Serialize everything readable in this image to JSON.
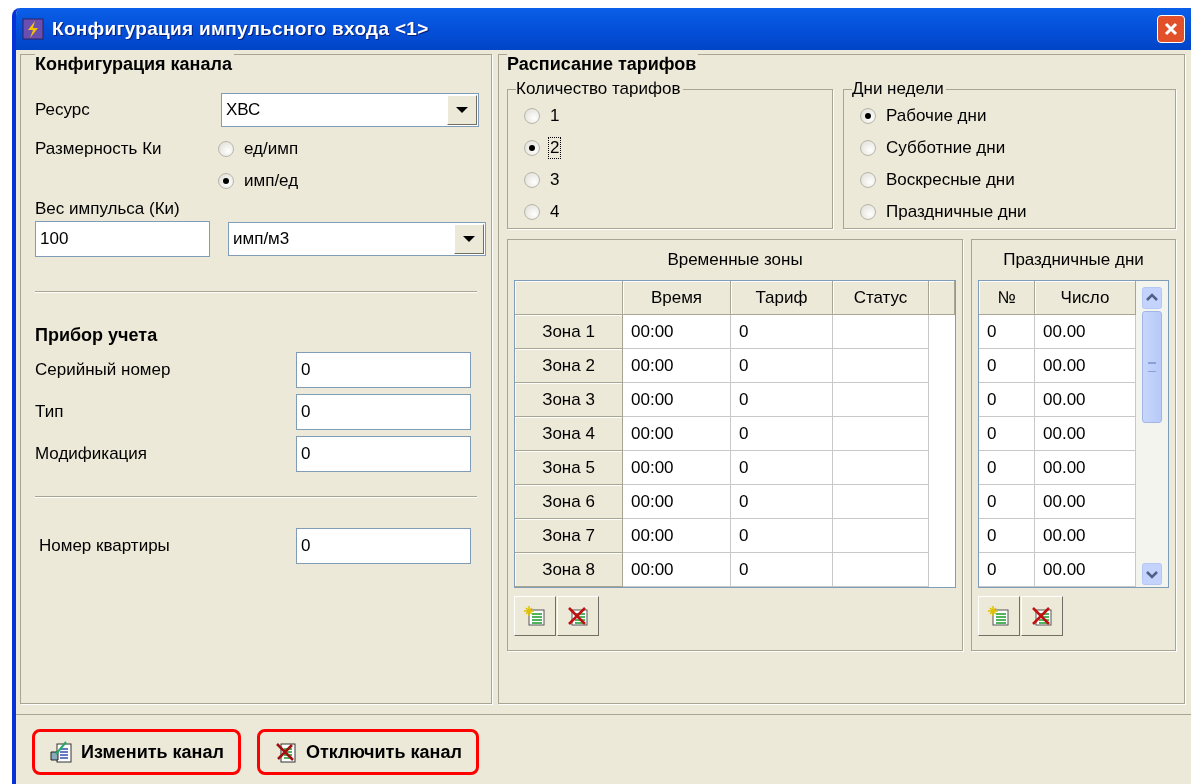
{
  "window": {
    "title": "Конфигурация импульсного входа <1>"
  },
  "channel_config": {
    "title": "Конфигурация канала",
    "resource": {
      "label": "Ресурс",
      "value": "ХВС"
    },
    "ki_dimension": {
      "label": "Размерность Ки",
      "options": [
        {
          "label": "ед/имп",
          "selected": false
        },
        {
          "label": "имп/ед",
          "selected": true
        }
      ]
    },
    "pulse_weight": {
      "label": "Вес импульса (Ки)",
      "value": "100",
      "unit": "имп/м3"
    }
  },
  "meter": {
    "title": "Прибор учета",
    "fields": [
      {
        "label": "Серийный номер",
        "value": "0"
      },
      {
        "label": "Тип",
        "value": "0"
      },
      {
        "label": "Модификация",
        "value": "0"
      }
    ]
  },
  "apartment": {
    "label": "Номер квартиры",
    "value": "0"
  },
  "tariff_schedule": {
    "title": "Расписание тарифов",
    "tariff_count": {
      "title": "Количество тарифов",
      "options": [
        {
          "label": "1",
          "selected": false,
          "focused": false
        },
        {
          "label": "2",
          "selected": true,
          "focused": true
        },
        {
          "label": "3",
          "selected": false,
          "focused": false
        },
        {
          "label": "4",
          "selected": false,
          "focused": false
        }
      ]
    },
    "weekdays": {
      "title": "Дни недели",
      "options": [
        {
          "label": "Рабочие дни",
          "selected": true
        },
        {
          "label": "Субботние дни",
          "selected": false
        },
        {
          "label": "Воскресные дни",
          "selected": false
        },
        {
          "label": "Праздничные дни",
          "selected": false
        }
      ]
    },
    "time_zones": {
      "title": "Временные зоны",
      "columns": [
        "Время",
        "Тариф",
        "Статус"
      ],
      "rows": [
        {
          "zone": "Зона 1",
          "time": "00:00",
          "tariff": "0"
        },
        {
          "zone": "Зона 2",
          "time": "00:00",
          "tariff": "0"
        },
        {
          "zone": "Зона 3",
          "time": "00:00",
          "tariff": "0"
        },
        {
          "zone": "Зона 4",
          "time": "00:00",
          "tariff": "0"
        },
        {
          "zone": "Зона 5",
          "time": "00:00",
          "tariff": "0"
        },
        {
          "zone": "Зона 6",
          "time": "00:00",
          "tariff": "0"
        },
        {
          "zone": "Зона 7",
          "time": "00:00",
          "tariff": "0"
        },
        {
          "zone": "Зона 8",
          "time": "00:00",
          "tariff": "0"
        }
      ]
    },
    "holidays": {
      "title": "Праздничные дни",
      "columns": [
        "№",
        "Число"
      ],
      "rows": [
        {
          "number": "0",
          "date": "00.00"
        },
        {
          "number": "0",
          "date": "00.00"
        },
        {
          "number": "0",
          "date": "00.00"
        },
        {
          "number": "0",
          "date": "00.00"
        },
        {
          "number": "0",
          "date": "00.00"
        },
        {
          "number": "0",
          "date": "00.00"
        },
        {
          "number": "0",
          "date": "00.00"
        },
        {
          "number": "0",
          "date": "00.00"
        }
      ]
    }
  },
  "buttons": [
    {
      "kind": "edit",
      "label": "Изменить канал",
      "highlighted": true
    },
    {
      "kind": "disable",
      "label": "Отключить канал",
      "highlighted": true
    }
  ]
}
